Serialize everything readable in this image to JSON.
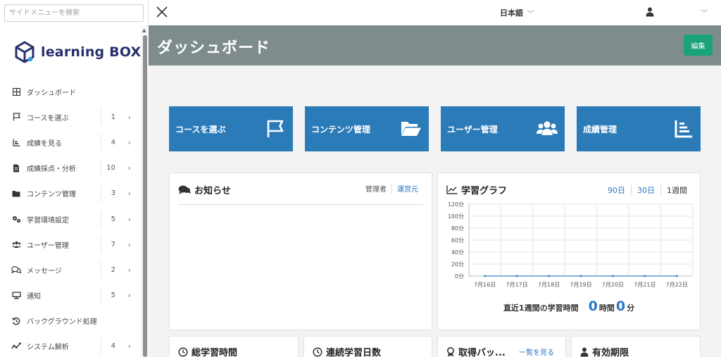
{
  "sidebar": {
    "search_placeholder": "サイドメニューを検索",
    "logo_text": "learning BOX",
    "items": [
      {
        "label": "ダッシュボード",
        "count": "",
        "icon": "dashboard-icon"
      },
      {
        "label": "コースを選ぶ",
        "count": "1",
        "icon": "flag-icon"
      },
      {
        "label": "成績を見る",
        "count": "4",
        "icon": "chart-icon"
      },
      {
        "label": "成績採点・分析",
        "count": "10",
        "icon": "document-icon"
      },
      {
        "label": "コンテンツ管理",
        "count": "3",
        "icon": "folder-icon"
      },
      {
        "label": "学習環境設定",
        "count": "5",
        "icon": "gears-icon"
      },
      {
        "label": "ユーザー管理",
        "count": "7",
        "icon": "users-icon"
      },
      {
        "label": "メッセージ",
        "count": "2",
        "icon": "messages-icon"
      },
      {
        "label": "通知",
        "count": "5",
        "icon": "monitor-icon"
      },
      {
        "label": "バックグラウンド処理",
        "count": "",
        "icon": "history-icon"
      },
      {
        "label": "システム解析",
        "count": "4",
        "icon": "analytics-icon"
      }
    ]
  },
  "topbar": {
    "language": "日本語"
  },
  "header": {
    "title": "ダッシュボード",
    "edit_label": "編集"
  },
  "tiles": [
    {
      "label": "コースを選ぶ",
      "icon": "flag-icon"
    },
    {
      "label": "コンテンツ管理",
      "icon": "folder-open-icon"
    },
    {
      "label": "ユーザー管理",
      "icon": "users-icon"
    },
    {
      "label": "成績管理",
      "icon": "chart-icon"
    }
  ],
  "news": {
    "title": "お知らせ",
    "tab_admin": "管理者",
    "tab_operator": "運営元"
  },
  "study_graph": {
    "title": "学習グラフ",
    "ranges": [
      "90日",
      "30日",
      "1週間"
    ],
    "total_label": "直近1週間の学習時間",
    "hours": "0",
    "hours_unit": "時間",
    "minutes": "0",
    "minutes_unit": "分",
    "y_ticks": [
      "120分",
      "100分",
      "80分",
      "60分",
      "40分",
      "20分",
      "0分"
    ],
    "x_ticks": [
      "7月16日",
      "7月17日",
      "7月18日",
      "7月19日",
      "7月20日",
      "7月21日",
      "7月22日"
    ]
  },
  "chart_data": {
    "type": "line",
    "categories": [
      "7月16日",
      "7月17日",
      "7月18日",
      "7月19日",
      "7月20日",
      "7月21日",
      "7月22日"
    ],
    "series": [
      {
        "values": [
          0,
          0,
          0,
          0,
          0,
          0,
          0
        ]
      }
    ],
    "ylim": [
      0,
      120
    ],
    "grid": true
  },
  "bottom_cards": {
    "total_time": "総学習時間",
    "streak": "連続学習日数",
    "badges": "取得バッ...",
    "badges_link": "一覧を見る",
    "expiry": "有効期限"
  },
  "colors": {
    "brand": "#27306b",
    "tile": "#2b7bb9",
    "header": "#7f8c8d",
    "accent_green": "#1aa37a",
    "link": "#2b78c5"
  }
}
